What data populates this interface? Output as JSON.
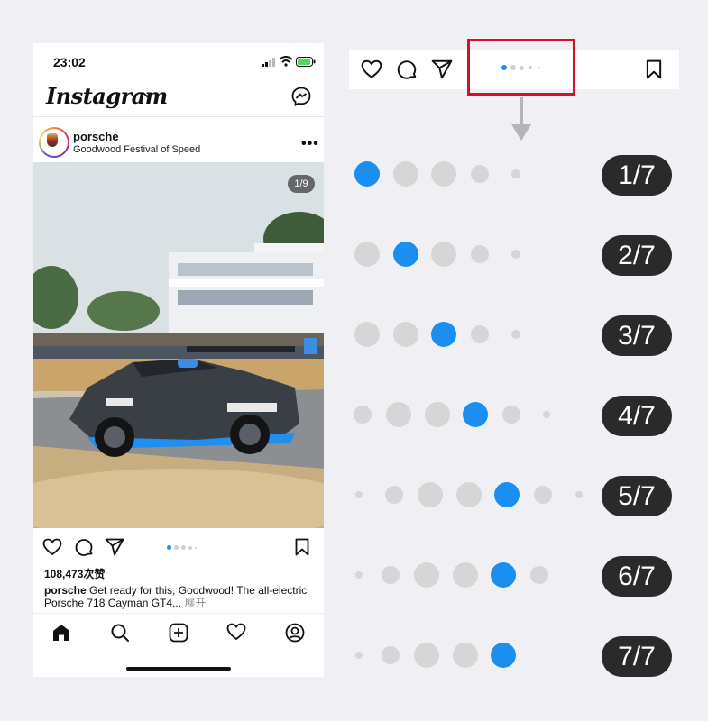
{
  "status_bar": {
    "time": "23:02"
  },
  "header": {
    "app_name": "Instagram"
  },
  "post": {
    "username": "porsche",
    "location": "Goodwood Festival of Speed",
    "image_counter": "1/9",
    "likes": "108,473次赞",
    "caption_user": "porsche",
    "caption_text": " Get ready for this, Goodwood! The all-electric Porsche 718 Cayman GT4... ",
    "caption_more": "展开"
  },
  "indicator_states": [
    {
      "label": "1/7"
    },
    {
      "label": "2/7"
    },
    {
      "label": "3/7"
    },
    {
      "label": "4/7"
    },
    {
      "label": "5/7"
    },
    {
      "label": "6/7"
    },
    {
      "label": "7/7"
    }
  ],
  "colors": {
    "active_dot": "#1a8ff0",
    "inactive_dot": "#d6d6d6",
    "highlight_box": "#d4102b",
    "label_pill": "#2a2a2a"
  },
  "icons": {
    "header": [
      "chevron-down-icon",
      "messenger-icon"
    ],
    "actions": [
      "heart-icon",
      "comment-icon",
      "share-icon",
      "bookmark-icon"
    ],
    "tabs": [
      "home-icon",
      "search-icon",
      "add-post-icon",
      "activity-heart-icon",
      "profile-icon"
    ]
  }
}
